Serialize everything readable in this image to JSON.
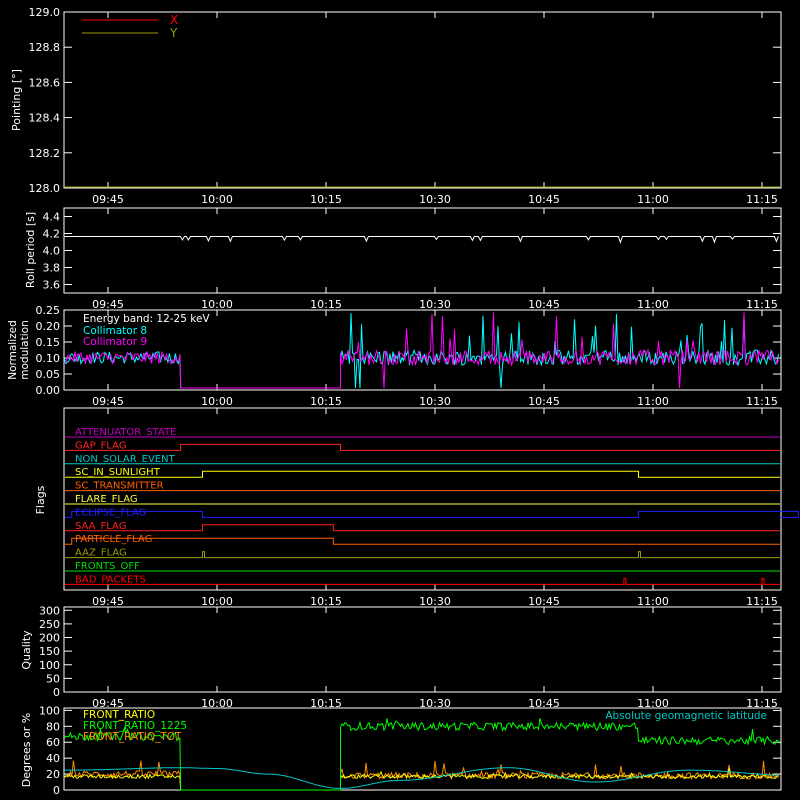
{
  "colors": {
    "background": "#000000",
    "axes": "#ffffff",
    "x_series": "#ff0000",
    "y_series": "#9a9a00",
    "collimator_8": "#00ffff",
    "collimator_9": "#ff00ff",
    "front_ratio": "#ffff00",
    "front_ratio_1225": "#00ff00",
    "front_ratio_alt": "#ff8c00",
    "geomag": "#00c8c8"
  },
  "time_ticks": [
    "09:45",
    "10:00",
    "10:15",
    "10:30",
    "10:45",
    "11:00",
    "11:15"
  ],
  "panels": {
    "pointing": {
      "ylabel": "Pointing [°]",
      "yticks": [
        "128.0",
        "128.2",
        "128.4",
        "128.6",
        "128.8",
        "129.0"
      ],
      "legend": [
        {
          "label": "X",
          "color": "#ff0000"
        },
        {
          "label": "Y",
          "color": "#9a9a00"
        }
      ]
    },
    "roll": {
      "ylabel": "Roll period [s]",
      "yticks": [
        "3.6",
        "3.8",
        "4.0",
        "4.2",
        "4.4"
      ]
    },
    "modulation": {
      "ylabel_line1": "Normalized",
      "ylabel_line2": "modulation",
      "yticks": [
        "0.00",
        "0.05",
        "0.10",
        "0.15",
        "0.20",
        "0.25"
      ],
      "band_label": "Energy band: 12-25 keV",
      "legend": [
        {
          "label": "Collimator 8",
          "color": "#00ffff"
        },
        {
          "label": "Collimator 9",
          "color": "#ff00ff"
        }
      ]
    },
    "flags": {
      "ylabel": "Flags",
      "rows": [
        {
          "label": "ATTENUATOR_STATE",
          "color": "#c000c0"
        },
        {
          "label": "GAP_FLAG",
          "color": "#ff2020"
        },
        {
          "label": "NON_SOLAR_EVENT",
          "color": "#00c8c8"
        },
        {
          "label": "SC_IN_SUNLIGHT",
          "color": "#ffff00"
        },
        {
          "label": "SC_TRANSMITTER",
          "color": "#ff6000"
        },
        {
          "label": "FLARE_FLAG",
          "color": "#ffff40"
        },
        {
          "label": "ECLIPSE_FLAG",
          "color": "#2020ff"
        },
        {
          "label": "SAA_FLAG",
          "color": "#ff2020"
        },
        {
          "label": "PARTICLE_FLAG",
          "color": "#ff6000"
        },
        {
          "label": "AAZ_FLAG",
          "color": "#9a9a00"
        },
        {
          "label": "FRONTS_OFF",
          "color": "#00e000"
        },
        {
          "label": "BAD_PACKETS",
          "color": "#ff0000"
        }
      ]
    },
    "quality": {
      "ylabel": "Quality",
      "yticks": [
        "0",
        "50",
        "100",
        "150",
        "200",
        "250",
        "300"
      ]
    },
    "ratio": {
      "ylabel": "Degrees or %",
      "yticks": [
        "0",
        "20",
        "40",
        "60",
        "80",
        "100"
      ],
      "legend": [
        {
          "label": "FRONT_RATIO",
          "color": "#ffff00"
        },
        {
          "label": "FRONT_RATIO_1225",
          "color": "#00ff00"
        },
        {
          "label": "FRONT_RATIO_TOT",
          "color": "#ff8c00"
        }
      ],
      "geomag_label": "Absolute geomagnetic latitude"
    }
  },
  "chart_data": [
    {
      "type": "line",
      "ylabel": "Pointing [°]",
      "ylim": [
        128.0,
        129.0
      ],
      "x_ticks": [
        "09:45",
        "10:00",
        "10:15",
        "10:30",
        "10:45",
        "11:00",
        "11:15"
      ],
      "series": [
        {
          "name": "X",
          "values": []
        },
        {
          "name": "Y",
          "values": []
        }
      ]
    },
    {
      "type": "line",
      "ylabel": "Roll period [s]",
      "ylim": [
        3.5,
        4.5
      ],
      "series": [
        {
          "x": [
            "09:40",
            "10:00",
            "10:15",
            "10:30",
            "10:45",
            "11:00",
            "11:20"
          ],
          "values": [
            4.17,
            4.16,
            4.17,
            4.17,
            4.16,
            4.17,
            4.16
          ]
        }
      ]
    },
    {
      "type": "line",
      "ylabel": "Normalized modulation",
      "ylim": [
        0.0,
        0.25
      ],
      "annotation": "Energy band: 12-25 keV",
      "series": [
        {
          "name": "Collimator 8",
          "segments": [
            [
              "09:40",
              "09:55",
              0.1
            ],
            [
              "10:17",
              "11:20",
              0.1
            ]
          ],
          "gap_value": 0.0
        },
        {
          "name": "Collimator 9",
          "segments": [
            [
              "09:40",
              "09:55",
              0.1
            ],
            [
              "10:17",
              "11:20",
              0.1
            ]
          ],
          "gap_value": 0.0
        }
      ]
    },
    {
      "type": "line",
      "ylabel": "Flags",
      "rows": [
        "ATTENUATOR_STATE",
        "GAP_FLAG",
        "NON_SOLAR_EVENT",
        "SC_IN_SUNLIGHT",
        "SC_TRANSMITTER",
        "FLARE_FLAG",
        "ECLIPSE_FLAG",
        "SAA_FLAG",
        "PARTICLE_FLAG",
        "AAZ_FLAG",
        "FRONTS_OFF",
        "BAD_PACKETS"
      ],
      "intervals": {
        "GAP_FLAG": [
          [
            "09:55",
            "10:17"
          ]
        ],
        "SC_IN_SUNLIGHT": [
          [
            "09:58",
            "10:58"
          ]
        ],
        "ECLIPSE_FLAG": [
          [
            "09:40",
            "09:58"
          ],
          [
            "10:58",
            "11:20"
          ]
        ],
        "SAA_FLAG": [
          [
            "09:58",
            "10:16"
          ]
        ],
        "PARTICLE_FLAG": [
          [
            "09:40",
            "10:16"
          ]
        ],
        "AAZ_FLAG": [
          [
            "09:58",
            "09:58"
          ],
          [
            "10:58",
            "10:58"
          ]
        ],
        "BAD_PACKETS": [
          [
            "10:56",
            "10:56"
          ],
          [
            "11:15",
            "11:15"
          ]
        ]
      }
    },
    {
      "type": "line",
      "ylabel": "Quality",
      "ylim": [
        0,
        300
      ],
      "series": []
    },
    {
      "type": "line",
      "ylabel": "Degrees or %",
      "ylim": [
        0,
        100
      ],
      "series": [
        {
          "name": "FRONT_RATIO",
          "segments": [
            [
              "09:40",
              "09:55",
              18
            ],
            [
              "10:17",
              "11:20",
              18
            ]
          ]
        },
        {
          "name": "FRONT_RATIO_1225",
          "segments": [
            [
              "09:40",
              "09:55",
              68
            ],
            [
              "10:17",
              "10:58",
              80
            ],
            [
              "10:58",
              "11:20",
              62
            ]
          ]
        },
        {
          "name": "FRONT_RATIO_TOT",
          "segments": [
            [
              "09:40",
              "09:55",
              20
            ],
            [
              "10:17",
              "11:20",
              18
            ]
          ]
        },
        {
          "name": "Absolute geomagnetic latitude",
          "x": [
            "09:40",
            "09:55",
            "10:00",
            "10:07",
            "10:17",
            "10:25",
            "10:40",
            "10:52",
            "11:05",
            "11:20"
          ],
          "values": [
            25,
            28,
            27,
            20,
            2,
            12,
            28,
            10,
            25,
            18
          ]
        }
      ]
    }
  ]
}
